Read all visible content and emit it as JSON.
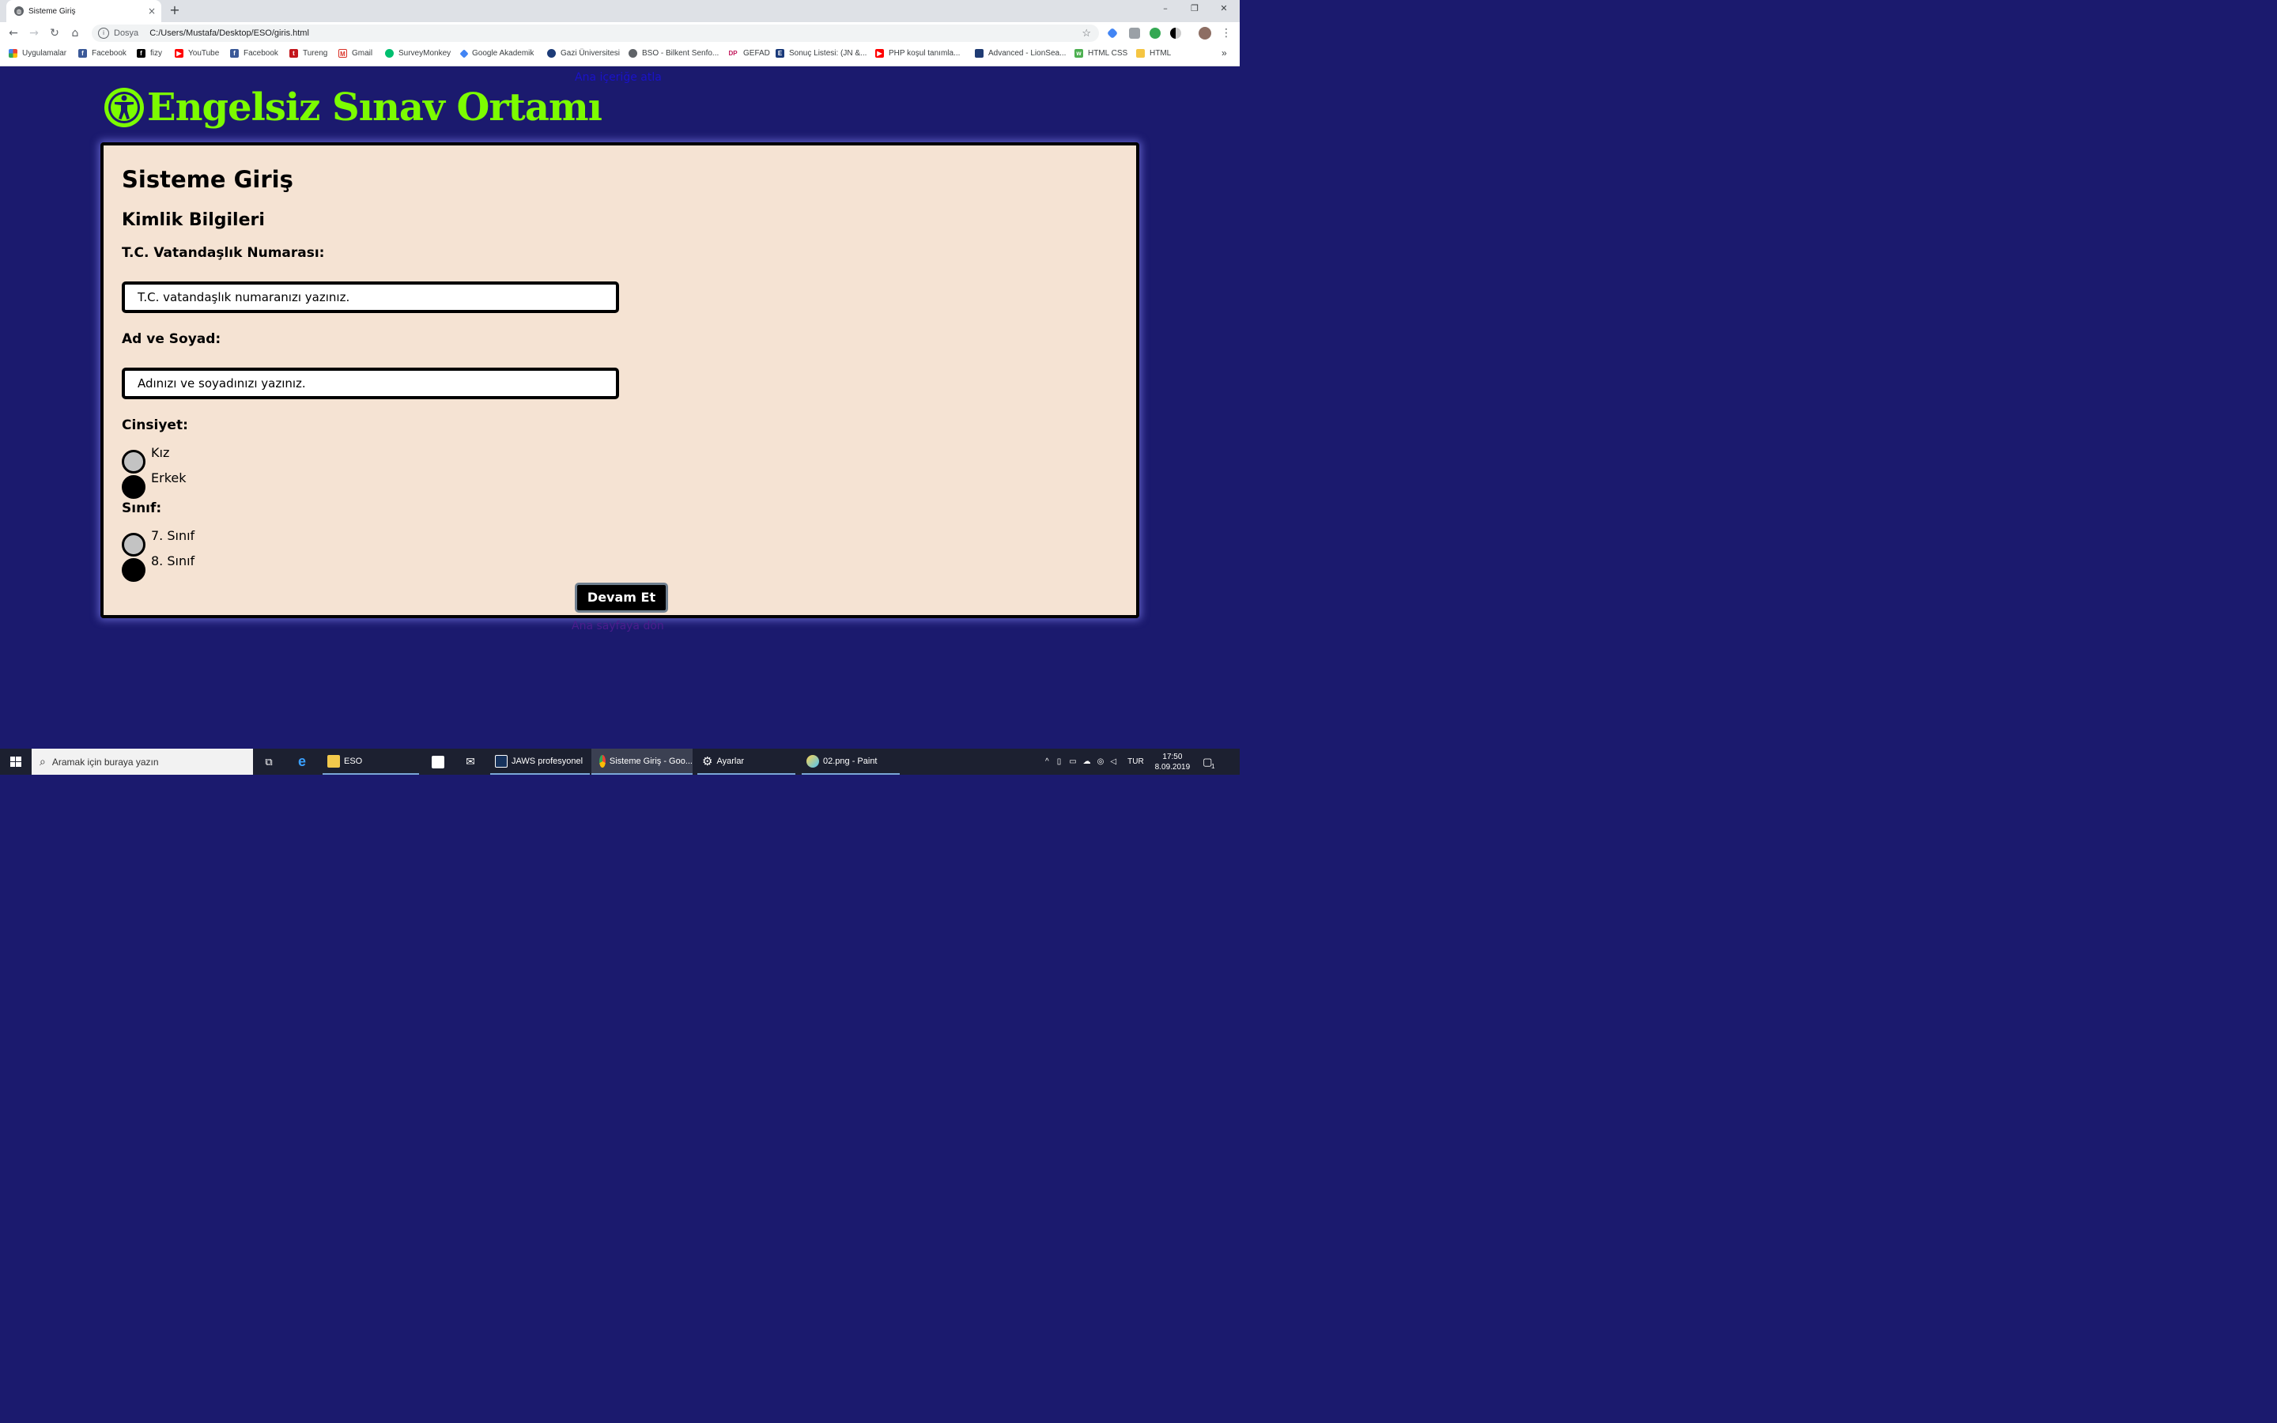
{
  "browser": {
    "tab_title": "Sisteme Giriş",
    "tab_close": "×",
    "new_tab": "+",
    "window_controls": [
      "–",
      "❐",
      "✕"
    ],
    "address": {
      "scheme_label": "Dosya",
      "url": "C:/Users/Mustafa/Desktop/ESO/giris.html"
    },
    "bookmarks": [
      {
        "label": "Uygulamalar",
        "icon": "apps-grid-icon",
        "color": "#e94235"
      },
      {
        "label": "Facebook",
        "icon": "facebook-icon",
        "color": "#3b5998"
      },
      {
        "label": "fizy",
        "icon": "fizy-icon",
        "color": "#000000"
      },
      {
        "label": "YouTube",
        "icon": "youtube-icon",
        "color": "#ff0000"
      },
      {
        "label": "Facebook",
        "icon": "facebook-icon",
        "color": "#3b5998"
      },
      {
        "label": "Tureng",
        "icon": "tureng-icon",
        "color": "#c4161c"
      },
      {
        "label": "Gmail",
        "icon": "gmail-icon",
        "color": "#d93025"
      },
      {
        "label": "SurveyMonkey",
        "icon": "surveymonkey-icon",
        "color": "#00bf6f"
      },
      {
        "label": "Google Akademik",
        "icon": "scholar-icon",
        "color": "#4285f4"
      },
      {
        "label": "Gazi Üniversitesi",
        "icon": "gazi-icon",
        "color": "#1d3c78"
      },
      {
        "label": "BSO - Bilkent Senfo...",
        "icon": "globe-icon",
        "color": "#5f6368"
      },
      {
        "label": "GEFAD",
        "icon": "gefad-icon",
        "color": "#c2185b"
      },
      {
        "label": "Sonuç Listesi: (JN &...",
        "icon": "ebsco-icon",
        "color": "#1a3a7a"
      },
      {
        "label": "PHP koşul tanımla...",
        "icon": "youtube-icon",
        "color": "#ff0000"
      },
      {
        "label": "Advanced - LionSea...",
        "icon": "lionsearch-icon",
        "color": "#1f3b73"
      },
      {
        "label": "HTML CSS",
        "icon": "w3-icon",
        "color": "#4caf50"
      },
      {
        "label": "HTML",
        "icon": "folder-icon",
        "color": "#f5c542"
      }
    ],
    "bookmarks_overflow": "»"
  },
  "page": {
    "skip_link": "Ana içeriğe atla",
    "site_title": "Engelsiz Sınav Ortamı",
    "heading": "Sisteme Giriş",
    "section": "Kimlik Bilgileri",
    "tc_label": "T.C. Vatandaşlık Numarası:",
    "tc_placeholder": "T.C. vatandaşlık numaranızı yazınız.",
    "name_label": "Ad ve Soyad:",
    "name_placeholder": "Adınızı ve soyadınızı yazınız.",
    "gender_label": "Cinsiyet:",
    "gender_options": [
      {
        "label": "Kız",
        "selected": false
      },
      {
        "label": "Erkek",
        "selected": true
      }
    ],
    "class_label": "Sınıf:",
    "class_options": [
      {
        "label": "7. Sınıf",
        "selected": false
      },
      {
        "label": "8. Sınıf",
        "selected": true
      }
    ],
    "submit": "Devam Et",
    "home_link": "Ana sayfaya dön",
    "colors": {
      "background": "#1b1a6e",
      "title": "#7cfc00",
      "panel": "#f5e3d3"
    }
  },
  "taskbar": {
    "search_placeholder": "Aramak için buraya yazın",
    "apps": [
      {
        "label": "ESO",
        "icon": "file-explorer-icon"
      },
      {
        "label": "JAWS profesyonel",
        "icon": "jaws-icon"
      },
      {
        "label": "Sisteme Giriş - Goo...",
        "icon": "chrome-icon"
      },
      {
        "label": "Ayarlar",
        "icon": "gear-icon"
      },
      {
        "label": "02.png - Paint",
        "icon": "paint-icon"
      }
    ],
    "language": "TUR",
    "time": "17:50",
    "date": "8.09.2019",
    "notifications": "1"
  }
}
